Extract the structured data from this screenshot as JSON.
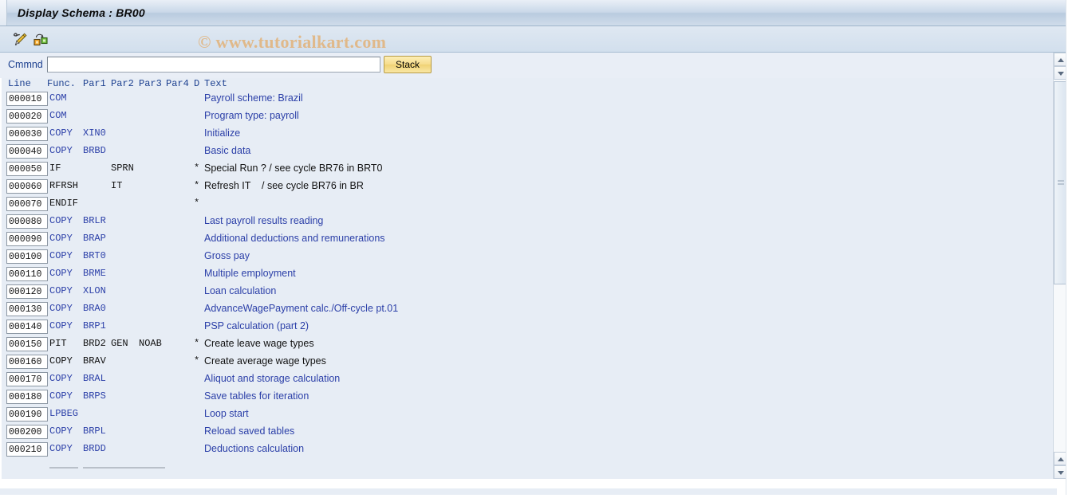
{
  "window": {
    "title": "Display Schema : BR00"
  },
  "toolbar": {
    "icons": [
      {
        "name": "display-change-pencil-icon",
        "label": "Display <-> Change"
      },
      {
        "name": "structure-navigation-icon",
        "label": "Schema structure"
      }
    ]
  },
  "watermark": {
    "text": "© www.tutorialkart.com",
    "color": "#e2b279"
  },
  "command": {
    "label": "Cmmnd",
    "value": "",
    "placeholder": "",
    "stack_label": "Stack"
  },
  "table": {
    "headers": {
      "line": "Line",
      "func": "Func.",
      "par1": "Par1",
      "par2": "Par2",
      "par3": "Par3",
      "par4": "Par4",
      "d": "D",
      "text": "Text"
    },
    "colors": {
      "active_text": "#2b3fa8",
      "inactive_text": "#111111",
      "row_background": "#e7edf5",
      "lineno_background": "#ffffff"
    },
    "rows": [
      {
        "line": "000010",
        "func": "COM",
        "par1": "",
        "par2": "",
        "par3": "",
        "par4": "",
        "d": "",
        "text": "Payroll scheme: Brazil",
        "style": "blue"
      },
      {
        "line": "000020",
        "func": "COM",
        "par1": "",
        "par2": "",
        "par3": "",
        "par4": "",
        "d": "",
        "text": "Program type: payroll",
        "style": "blue"
      },
      {
        "line": "000030",
        "func": "COPY",
        "par1": "XIN0",
        "par2": "",
        "par3": "",
        "par4": "",
        "d": "",
        "text": "Initialize",
        "style": "blue"
      },
      {
        "line": "000040",
        "func": "COPY",
        "par1": "BRBD",
        "par2": "",
        "par3": "",
        "par4": "",
        "d": "",
        "text": "Basic data",
        "style": "blue"
      },
      {
        "line": "000050",
        "func": "IF",
        "par1": "",
        "par2": "SPRN",
        "par3": "",
        "par4": "",
        "d": "*",
        "text": "Special Run ? / see cycle BR76 in BRT0",
        "style": "black"
      },
      {
        "line": "000060",
        "func": "RFRSH",
        "par1": "",
        "par2": "IT",
        "par3": "",
        "par4": "",
        "d": "*",
        "text": "Refresh IT    / see cycle BR76 in BR",
        "style": "black"
      },
      {
        "line": "000070",
        "func": "ENDIF",
        "par1": "",
        "par2": "",
        "par3": "",
        "par4": "",
        "d": "*",
        "text": "",
        "style": "black"
      },
      {
        "line": "000080",
        "func": "COPY",
        "par1": "BRLR",
        "par2": "",
        "par3": "",
        "par4": "",
        "d": "",
        "text": "Last payroll results reading",
        "style": "blue"
      },
      {
        "line": "000090",
        "func": "COPY",
        "par1": "BRAP",
        "par2": "",
        "par3": "",
        "par4": "",
        "d": "",
        "text": "Additional deductions and remunerations",
        "style": "blue"
      },
      {
        "line": "000100",
        "func": "COPY",
        "par1": "BRT0",
        "par2": "",
        "par3": "",
        "par4": "",
        "d": "",
        "text": "Gross pay",
        "style": "blue"
      },
      {
        "line": "000110",
        "func": "COPY",
        "par1": "BRME",
        "par2": "",
        "par3": "",
        "par4": "",
        "d": "",
        "text": "Multiple employment",
        "style": "blue"
      },
      {
        "line": "000120",
        "func": "COPY",
        "par1": "XLON",
        "par2": "",
        "par3": "",
        "par4": "",
        "d": "",
        "text": "Loan calculation",
        "style": "blue"
      },
      {
        "line": "000130",
        "func": "COPY",
        "par1": "BRA0",
        "par2": "",
        "par3": "",
        "par4": "",
        "d": "",
        "text": "AdvanceWagePayment calc./Off-cycle pt.01",
        "style": "blue"
      },
      {
        "line": "000140",
        "func": "COPY",
        "par1": "BRP1",
        "par2": "",
        "par3": "",
        "par4": "",
        "d": "",
        "text": "PSP calculation (part 2)",
        "style": "blue"
      },
      {
        "line": "000150",
        "func": "PIT",
        "par1": "BRD2",
        "par2": "GEN",
        "par3": "NOAB",
        "par4": "",
        "d": "*",
        "text": "Create leave wage types",
        "style": "black"
      },
      {
        "line": "000160",
        "func": "COPY",
        "par1": "BRAV",
        "par2": "",
        "par3": "",
        "par4": "",
        "d": "*",
        "text": "Create average wage types",
        "style": "black"
      },
      {
        "line": "000170",
        "func": "COPY",
        "par1": "BRAL",
        "par2": "",
        "par3": "",
        "par4": "",
        "d": "",
        "text": "Aliquot and storage calculation",
        "style": "blue"
      },
      {
        "line": "000180",
        "func": "COPY",
        "par1": "BRPS",
        "par2": "",
        "par3": "",
        "par4": "",
        "d": "",
        "text": "Save tables for iteration",
        "style": "blue"
      },
      {
        "line": "000190",
        "func": "LPBEG",
        "par1": "",
        "par2": "",
        "par3": "",
        "par4": "",
        "d": "",
        "text": "Loop start",
        "style": "blue"
      },
      {
        "line": "000200",
        "func": "COPY",
        "par1": "BRPL",
        "par2": "",
        "par3": "",
        "par4": "",
        "d": "",
        "text": "Reload saved tables",
        "style": "blue"
      },
      {
        "line": "000210",
        "func": "COPY",
        "par1": "BRDD",
        "par2": "",
        "par3": "",
        "par4": "",
        "d": "",
        "text": "Deductions calculation",
        "style": "blue"
      }
    ]
  },
  "scrollbars": {
    "vertical": {
      "up": "▲",
      "down": "▼"
    },
    "horizontal": {}
  }
}
